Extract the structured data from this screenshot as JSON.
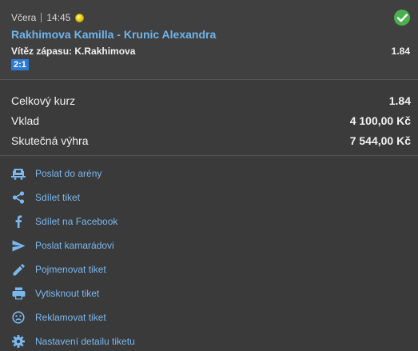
{
  "bet": {
    "day": "Včera",
    "time": "14:45",
    "sport_icon": "tennis-ball-icon",
    "status_icon": "check-circle-icon",
    "match": "Rakhimova Kamilla - Krunic Alexandra",
    "pick": "Vítěz zápasu: K.Rakhimova",
    "odd": "1.84",
    "score": "2:1"
  },
  "summary": {
    "total_odds_label": "Celkový kurz",
    "total_odds_value": "1.84",
    "stake_label": "Vklad",
    "stake_value": "4 100,00 Kč",
    "payout_label": "Skutečná výhra",
    "payout_value": "7 544,00 Kč"
  },
  "actions": [
    {
      "label": "Poslat do arény",
      "icon": "arena-icon"
    },
    {
      "label": "Sdílet tiket",
      "icon": "share-icon"
    },
    {
      "label": "Sdílet na Facebook",
      "icon": "facebook-icon"
    },
    {
      "label": "Poslat kamarádovi",
      "icon": "send-icon"
    },
    {
      "label": "Pojmenovat tiket",
      "icon": "pencil-icon"
    },
    {
      "label": "Vytisknout tiket",
      "icon": "printer-icon"
    },
    {
      "label": "Reklamovat tiket",
      "icon": "sad-face-icon"
    },
    {
      "label": "Nastavení detailu tiketu",
      "icon": "gear-icon"
    }
  ],
  "colors": {
    "link": "#7ab8ef",
    "match_title": "#6fb4ec",
    "success": "#4caf50",
    "score_badge": "#2b7ad6"
  }
}
